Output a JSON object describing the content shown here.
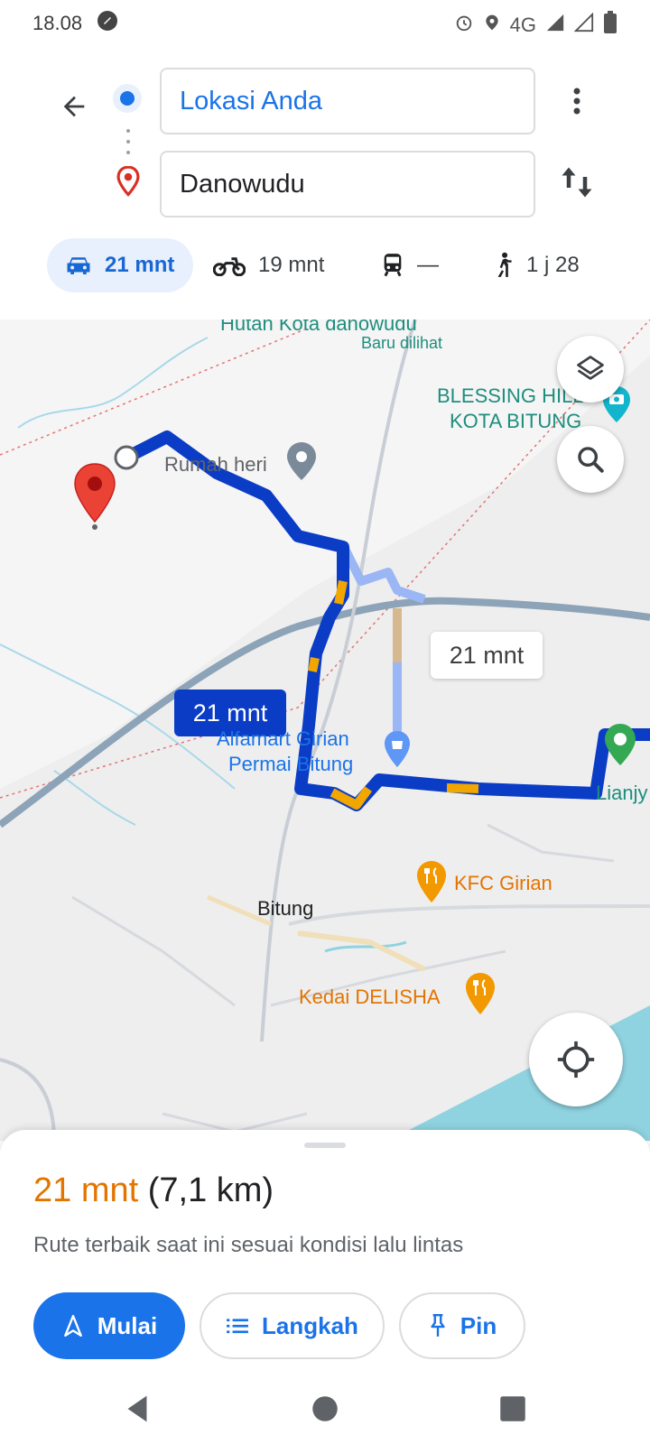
{
  "status": {
    "time": "18.08",
    "network": "4G",
    "icons": [
      "app-notification-icon",
      "alarm-icon",
      "location-icon",
      "signal-icon",
      "battery-icon"
    ]
  },
  "search": {
    "origin": "Lokasi Anda",
    "destination": "Danowudu"
  },
  "modes": [
    {
      "name": "car",
      "label": "21 mnt",
      "active": true
    },
    {
      "name": "motorcycle",
      "label": "19 mnt"
    },
    {
      "name": "transit",
      "label": "—"
    },
    {
      "name": "walk",
      "label": "1 j 28"
    }
  ],
  "map": {
    "labels": {
      "hutan": "Hutan Kota danowudu",
      "baru": "Baru dilihat",
      "blessing_1": "BLESSING HILL",
      "blessing_2": "KOTA BITUNG",
      "rumah": "Rumah heri",
      "alfamart_1": "Alfamart Girian",
      "alfamart_2": "Permai Bitung",
      "kfc": "KFC Girian",
      "bitung": "Bitung",
      "kedai": "Kedai DELISHA",
      "lianjy": "Lianjy"
    },
    "route_time_primary": "21 mnt",
    "route_time_alt": "21 mnt"
  },
  "sheet": {
    "duration": "21 mnt",
    "distance": "(7,1 km)",
    "description": "Rute terbaik saat ini sesuai kondisi lalu lintas",
    "start_label": "Mulai",
    "steps_label": "Langkah",
    "pin_label": "Pin"
  },
  "colors": {
    "accent": "#1a73e8",
    "route": "#0b3cc6",
    "traffic": "#f2a600",
    "duration": "#e37400",
    "water": "#8fd3e0"
  }
}
